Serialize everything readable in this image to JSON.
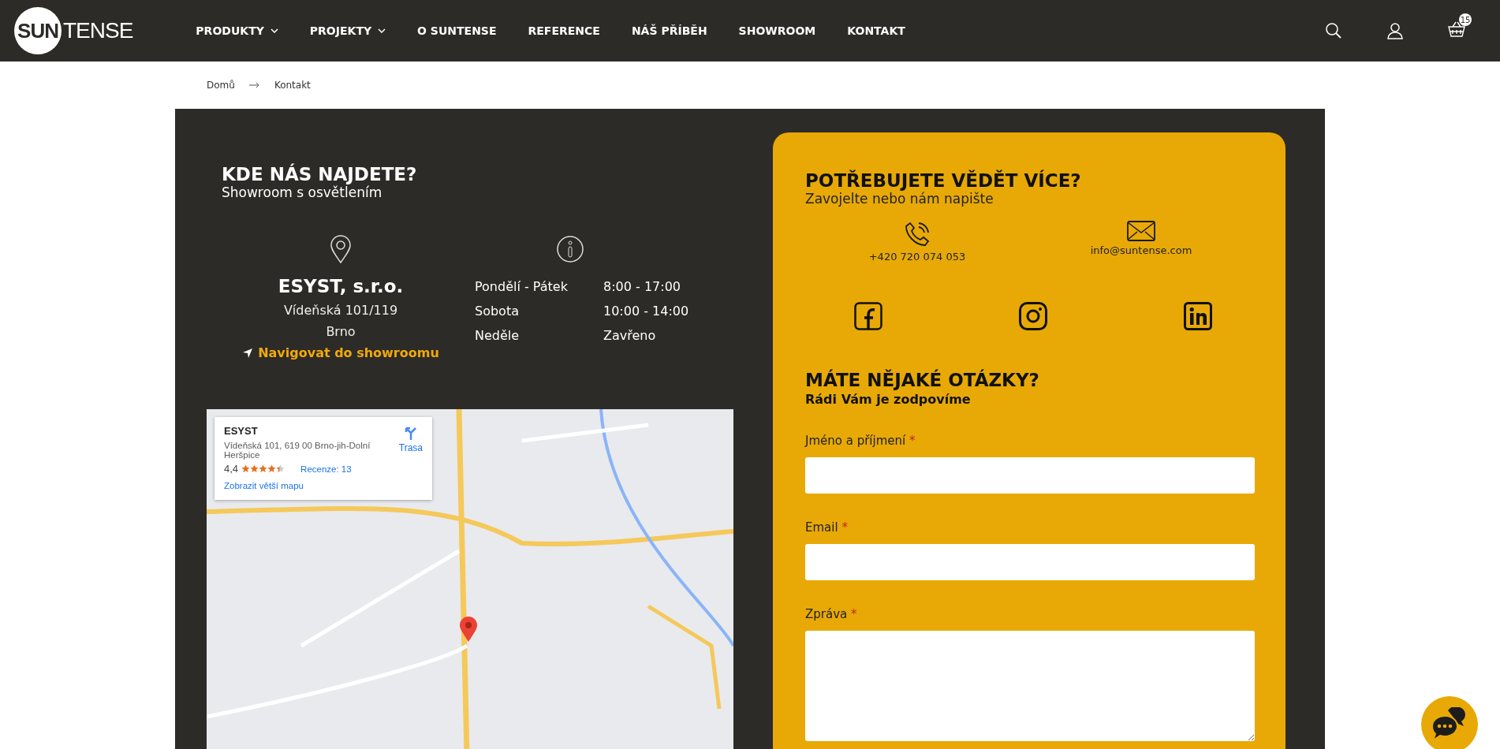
{
  "header": {
    "logo": {
      "left": "SUN",
      "right": "TENSE"
    },
    "nav": [
      {
        "label": "PRODUKTY",
        "has_dropdown": true
      },
      {
        "label": "PROJEKTY",
        "has_dropdown": true
      },
      {
        "label": "O SUNTENSE",
        "has_dropdown": false
      },
      {
        "label": "REFERENCE",
        "has_dropdown": false
      },
      {
        "label": "NÁŠ PŘÍBĚH",
        "has_dropdown": false
      },
      {
        "label": "SHOWROOM",
        "has_dropdown": false
      },
      {
        "label": "KONTAKT",
        "has_dropdown": false
      }
    ],
    "cart_count": "15"
  },
  "breadcrumb": [
    "Domů",
    "Kontakt"
  ],
  "location": {
    "title": "KDE NÁS NAJDETE?",
    "subtitle": "Showroom s osvětlením",
    "company": "ESYST, s.r.o.",
    "street": "Vídeňská 101/119",
    "city": "Brno",
    "navigate_link": "Navigovat do showroomu",
    "hours": [
      {
        "day": "Pondělí - Pátek",
        "time": "8:00 - 17:00"
      },
      {
        "day": "Sobota",
        "time": "10:00 - 14:00"
      },
      {
        "day": "Neděle",
        "time": "Zavřeno"
      }
    ]
  },
  "map_card": {
    "name": "ESYST",
    "address": "Vídeňská 101, 619 00 Brno-jih-Dolní Heršpice",
    "rating": "4,4",
    "stars": 4.4,
    "reviews": "Recenze: 13",
    "directions": "Trasa",
    "larger_map_link": "Zobrazit větší mapu"
  },
  "contact": {
    "title": "POTŘEBUJETE VĚDĚT VÍCE?",
    "subtitle": "Zavojelte nebo nám napište",
    "channels": [
      {
        "kind": "phone",
        "text": "+420 720 074 053"
      },
      {
        "kind": "email",
        "text": "info@suntense.com"
      }
    ],
    "social": [
      {
        "kind": "facebook"
      },
      {
        "kind": "instagram"
      },
      {
        "kind": "linkedin"
      }
    ]
  },
  "form": {
    "title": "MÁTE NĚJAKÉ OTÁZKY?",
    "subtitle": "Rádi Vám je zodpovíme",
    "fields": [
      {
        "kind": "input",
        "label": "Jméno a příjmení",
        "marker": "*"
      },
      {
        "kind": "input",
        "label": "Email",
        "marker": "*"
      },
      {
        "kind": "textarea",
        "label": "Zpráva",
        "marker": "*"
      }
    ]
  }
}
